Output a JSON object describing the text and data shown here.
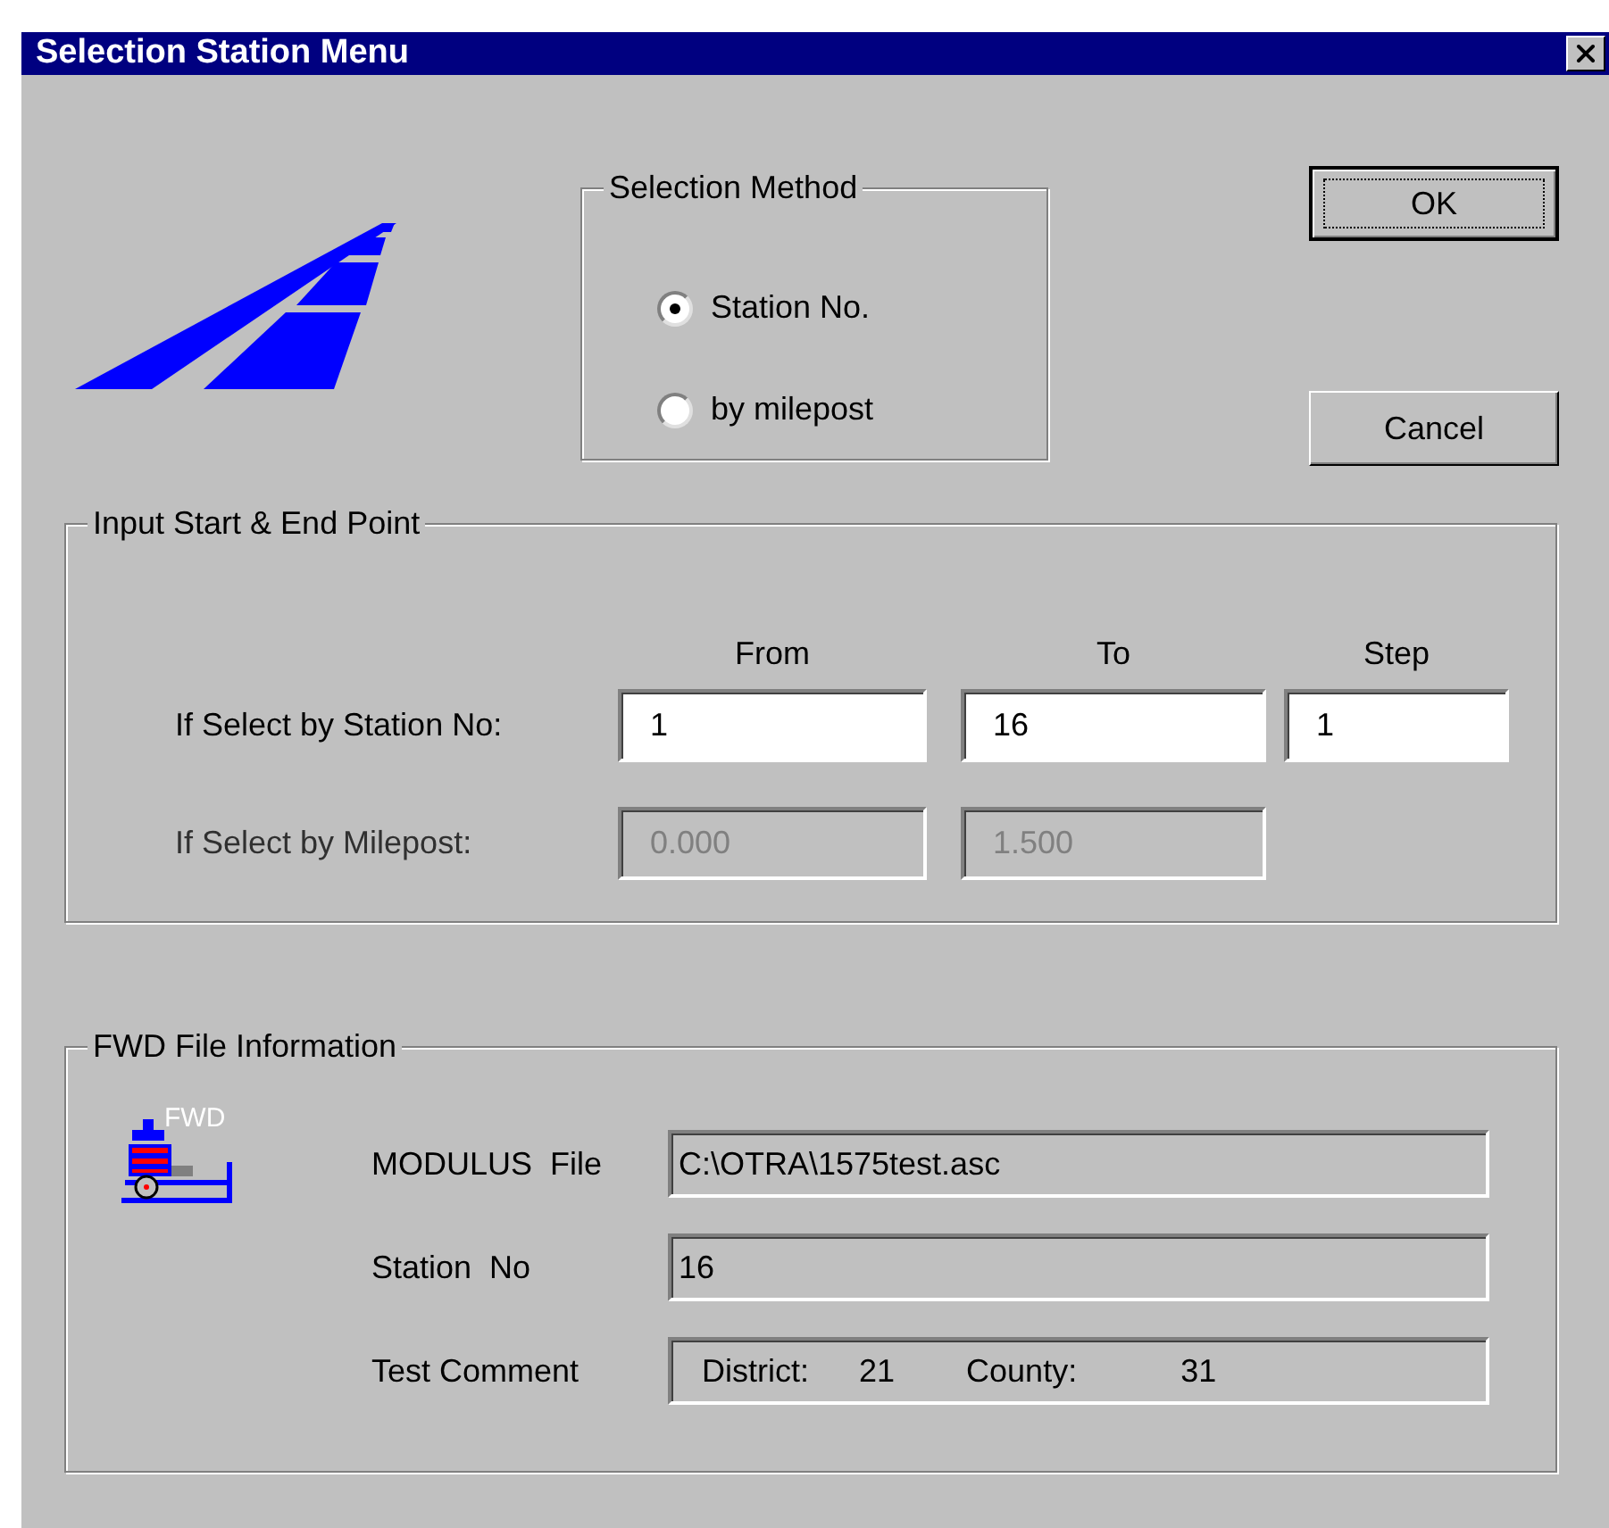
{
  "window": {
    "title": "Selection Station Menu"
  },
  "selection_method": {
    "title": "Selection Method",
    "options": [
      {
        "label": "Station No.",
        "selected": true
      },
      {
        "label": "by milepost",
        "selected": false
      }
    ]
  },
  "buttons": [
    {
      "label": "OK",
      "focused": true
    },
    {
      "label": "Cancel",
      "focused": false
    }
  ],
  "input_group": {
    "title": "Input Start & End Point",
    "columns": [
      "From",
      "To",
      "Step"
    ],
    "rows": [
      {
        "label": "If Select by Station No:",
        "disabled": false,
        "values": [
          "1",
          "16",
          "1"
        ]
      },
      {
        "label": "If Select by Milepost:",
        "disabled": true,
        "values": [
          "0.000",
          "1.500"
        ]
      }
    ]
  },
  "fwd_group": {
    "title": "FWD File Information",
    "icon_label": "FWD",
    "fields": [
      {
        "label": "MODULUS  File",
        "kind": "text",
        "value": "C:\\OTRA\\1575test.asc"
      },
      {
        "label": "Station  No",
        "kind": "text",
        "value": "16"
      },
      {
        "label": "Test Comment",
        "kind": "pairs",
        "values": [
          "District:",
          "21",
          "County:",
          "31"
        ]
      }
    ]
  }
}
